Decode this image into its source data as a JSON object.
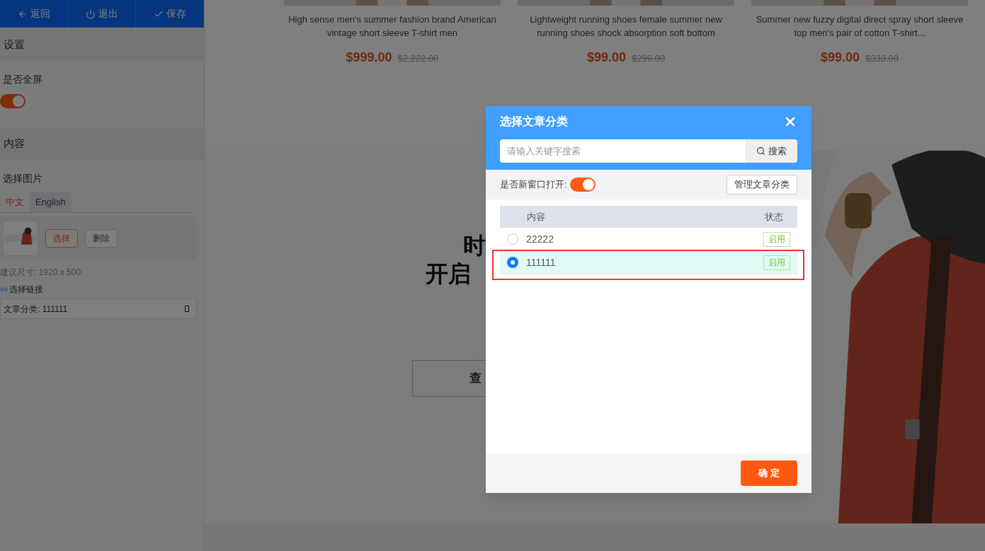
{
  "sidebar": {
    "toolbar": [
      {
        "label": "返回",
        "kind": "back"
      },
      {
        "label": "退出",
        "kind": "exit"
      },
      {
        "label": "保存",
        "kind": "save"
      }
    ],
    "settings_header": "设置",
    "fullscreen": {
      "label": "是否全屏",
      "on": true
    },
    "content_header": "内容",
    "image_label": "选择图片",
    "tabs": [
      {
        "label": "中文",
        "selected": true
      },
      {
        "label": "English",
        "selected": false
      }
    ],
    "image_buttons": [
      {
        "label": "选择",
        "kind": "primary"
      },
      {
        "label": "删除",
        "kind": "plain"
      }
    ],
    "size_hint": "建议尺寸: 1920 x 500",
    "link_label": "选择链接",
    "link_value": "文章分类: 111111"
  },
  "products": [
    {
      "title": "High sense men's summer fashion brand American vintage short sleeve T-shirt men",
      "price": "$999.00",
      "old_price": "$2,222.00"
    },
    {
      "title": "Lightweight running shoes female summer new running shoes shock absorption soft bottom",
      "price": "$99.00",
      "old_price": "$299.00"
    },
    {
      "title": "Summer new fuzzy digital direct spray short sleeve top men's pair of cotton T-shirt...",
      "price": "$99.00",
      "old_price": "$333.00"
    }
  ],
  "hero": {
    "line_1": "时",
    "line_2": "开启",
    "button": "查"
  },
  "dialog": {
    "title": "选择文章分类",
    "search": {
      "placeholder": "请输入关键字搜索",
      "button": "搜索"
    },
    "new_window": {
      "label": "是否新窗口打开:",
      "on": true
    },
    "manage_button": "管理文章分类",
    "columns": [
      "内容",
      "状态"
    ],
    "rows": [
      {
        "name": "22222",
        "status": "启用",
        "selected": false
      },
      {
        "name": "111111",
        "status": "启用",
        "selected": true
      }
    ],
    "confirm_button": "确 定"
  }
}
